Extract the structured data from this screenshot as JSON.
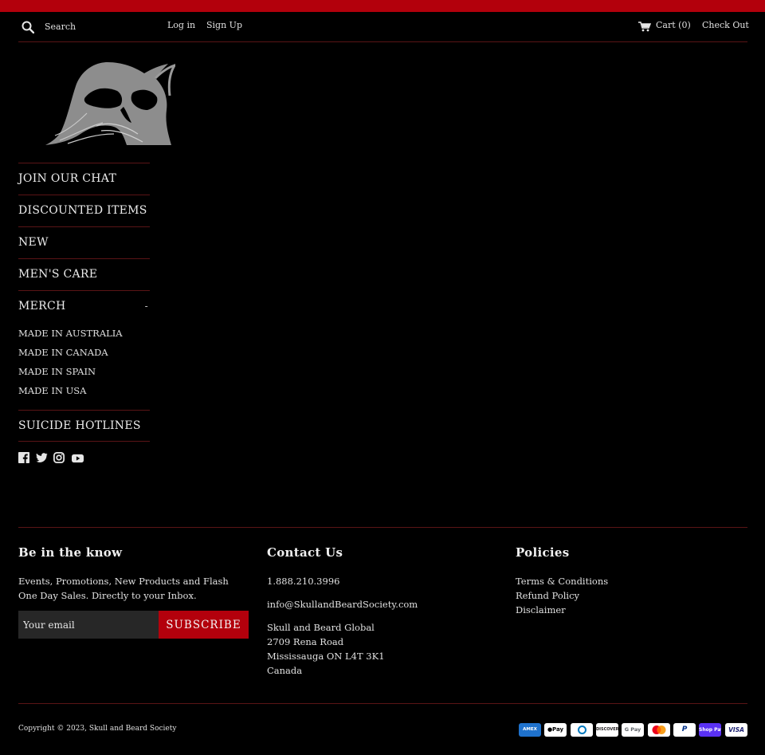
{
  "header": {
    "search_placeholder": "Search",
    "login": "Log in",
    "signup": "Sign Up",
    "cart": "Cart (0)",
    "checkout": "Check Out"
  },
  "nav": {
    "items": [
      {
        "label": "JOIN OUR CHAT"
      },
      {
        "label": "DISCOUNTED ITEMS"
      },
      {
        "label": "NEW"
      },
      {
        "label": "MEN'S CARE"
      },
      {
        "label": "MERCH",
        "toggle": "-"
      }
    ],
    "merch_sub": [
      "MADE IN AUSTRALIA",
      "MADE IN CANADA",
      "MADE IN SPAIN",
      "MADE IN USA"
    ],
    "last": "SUICIDE HOTLINES"
  },
  "social": [
    "facebook-icon",
    "twitter-icon",
    "instagram-icon",
    "youtube-icon"
  ],
  "footer": {
    "know": {
      "title": "Be in the know",
      "text": "Events, Promotions, New Products and Flash One Day Sales. Directly to your Inbox.",
      "email_placeholder": "Your email",
      "subscribe": "SUBSCRIBE"
    },
    "contact": {
      "title": "Contact Us",
      "phone": "1.888.210.3996",
      "email": "info@SkullandBeardSociety.com",
      "address": [
        "Skull and Beard Global",
        "2709 Rena Road",
        "Mississauga ON L4T 3K1",
        "Canada"
      ]
    },
    "policies": {
      "title": "Policies",
      "links": [
        "Terms & Conditions",
        "Refund Policy",
        "Disclaimer"
      ]
    },
    "copyright_prefix": "Copyright © 2023, ",
    "copyright_name": "Skull and Beard Society",
    "payments": [
      {
        "name": "american-express-icon",
        "label": "AMEX"
      },
      {
        "name": "apple-pay-icon",
        "label": "Pay"
      },
      {
        "name": "diners-club-icon",
        "label": "D"
      },
      {
        "name": "discover-icon",
        "label": "DISCOVER"
      },
      {
        "name": "google-pay-icon",
        "label": "G Pay"
      },
      {
        "name": "mastercard-icon",
        "label": ""
      },
      {
        "name": "paypal-icon",
        "label": "P"
      },
      {
        "name": "shop-pay-icon",
        "label": "Shop Pay"
      },
      {
        "name": "visa-icon",
        "label": "VISA"
      }
    ]
  },
  "colors": {
    "accent": "#b3000c",
    "background": "#000000",
    "divider": "#5a1416",
    "text": "#e9e9e9",
    "input_bg": "#272727"
  }
}
